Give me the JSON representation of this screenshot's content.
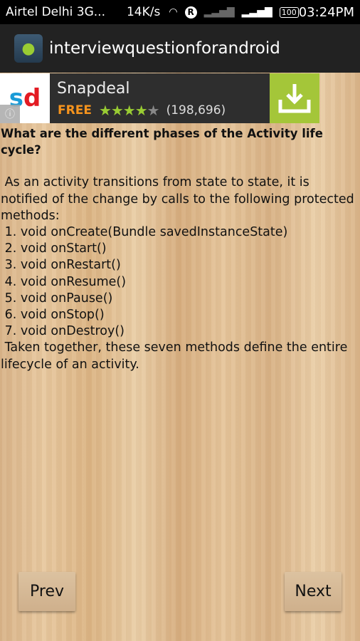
{
  "status_bar": {
    "carrier": "Airtel Delhi 3G...",
    "speed": "14K/s",
    "roaming": "R",
    "battery": "100",
    "time": "03:24PM"
  },
  "action_bar": {
    "title": "interviewquestionforandroid",
    "icon": "android-app-icon"
  },
  "ad": {
    "logo_s": "s",
    "logo_d": "d",
    "name": "Snapdeal",
    "price": "FREE",
    "rating": 4,
    "rating_max": 5,
    "reviews": "(198,696)",
    "colors": {
      "install": "#a4c639",
      "free": "#f7941d"
    }
  },
  "content": {
    "question": "What are the different phases of the Activity life cycle?",
    "intro": " As an activity transitions from state to state, it is notified of the change by calls to the following protected methods:",
    "methods": [
      " 1. void onCreate(Bundle savedInstanceState)",
      " 2. void onStart()",
      " 3. void onRestart()",
      " 4. void onResume()",
      " 5. void onPause()",
      " 6. void onStop()",
      " 7. void onDestroy()"
    ],
    "outro": " Taken together, these seven methods define the entire lifecycle of an activity."
  },
  "nav": {
    "prev": "Prev",
    "next": "Next"
  }
}
